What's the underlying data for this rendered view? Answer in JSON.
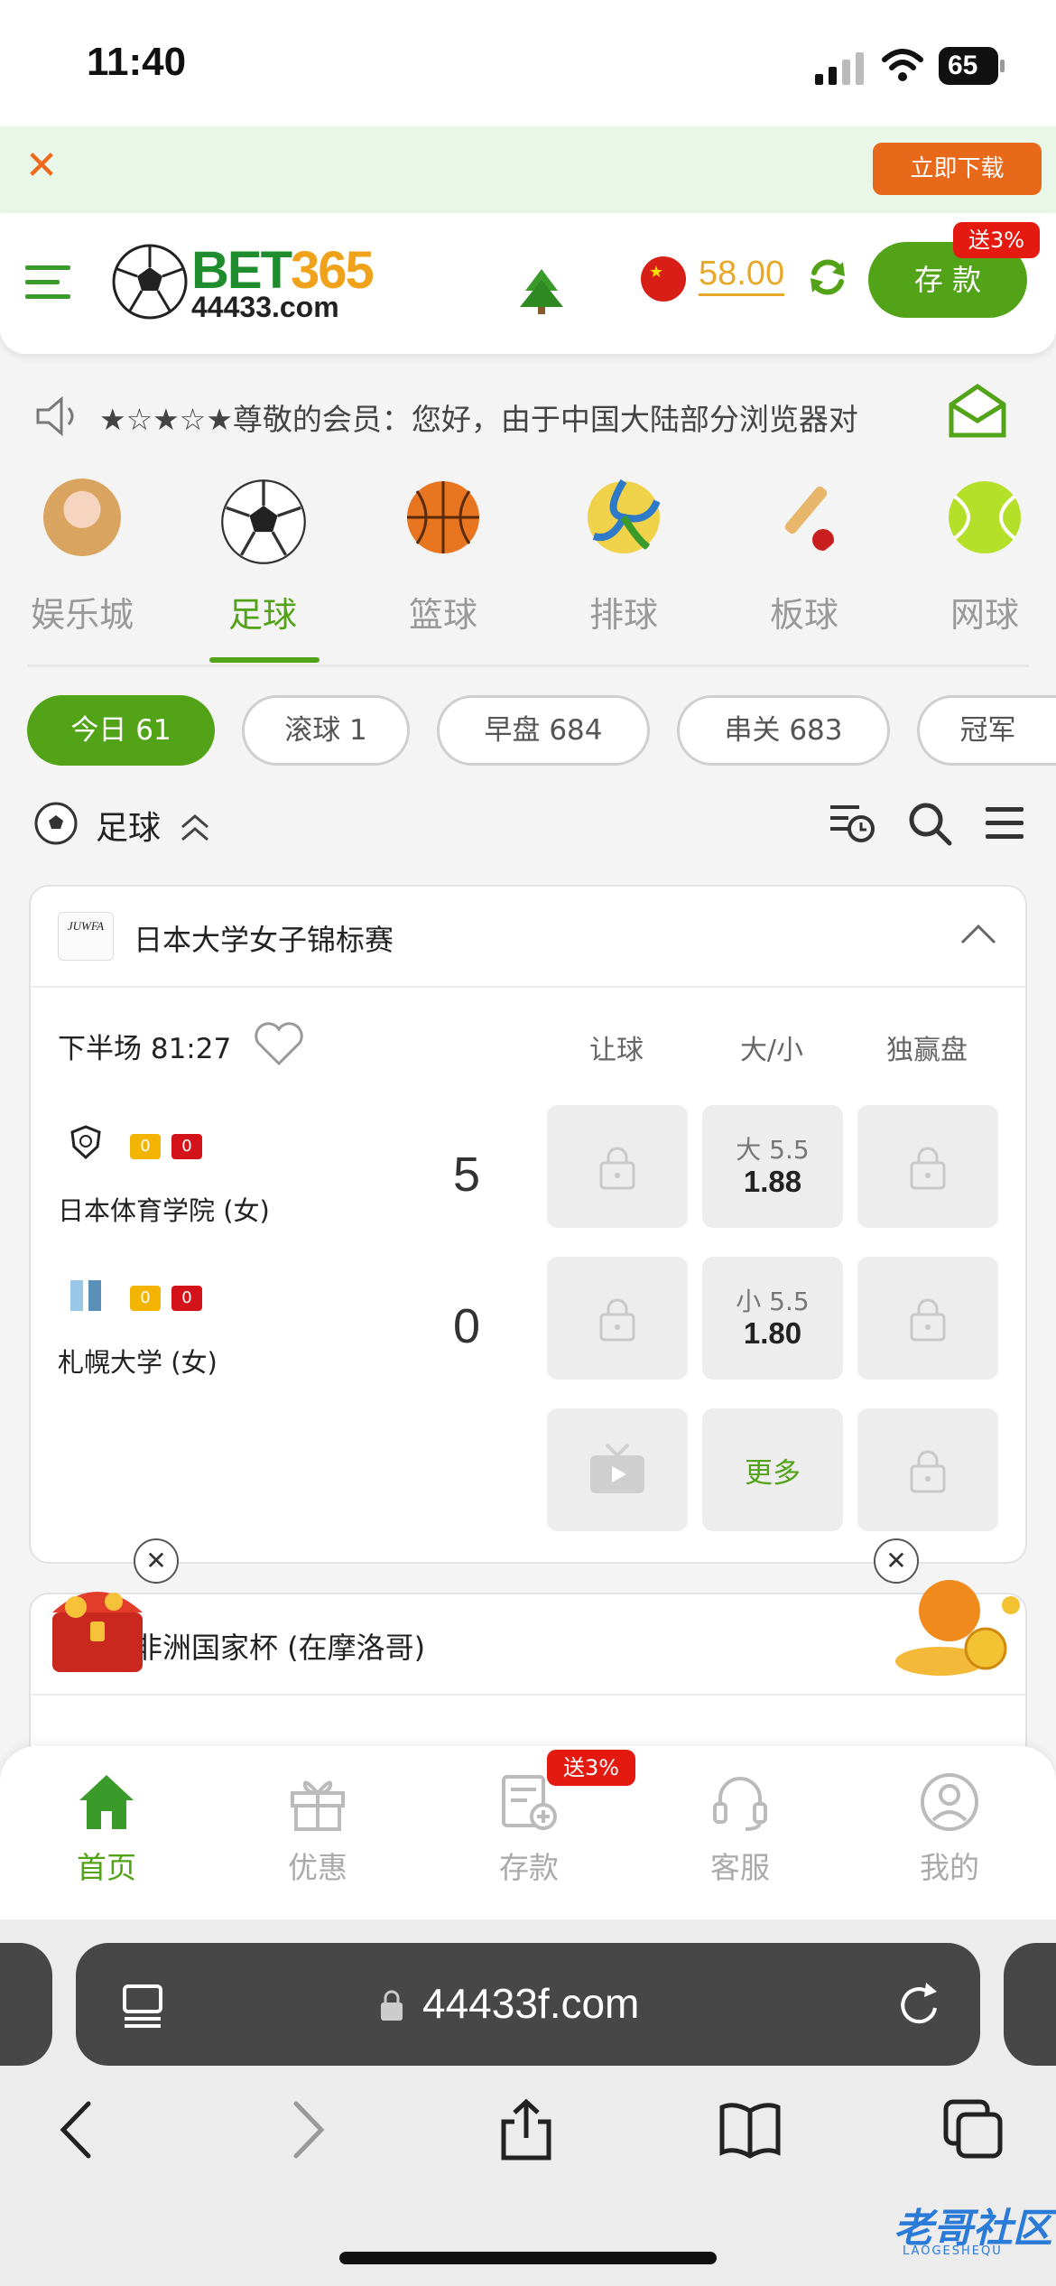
{
  "status_bar": {
    "time": "11:40",
    "battery": "65"
  },
  "banner": {
    "download_label": "立即下载"
  },
  "header": {
    "brand_text": "BET",
    "brand_num": "365",
    "brand_domain": "44433.com",
    "balance": "58.00",
    "deposit_label": "存 款",
    "deposit_badge": "送3%"
  },
  "notice": {
    "text": "★☆★☆★尊敬的会员：您好，由于中国大陆部分浏览器对"
  },
  "sport_tabs": [
    {
      "label": "娱乐城",
      "icon": "casino-girl-icon"
    },
    {
      "label": "足球",
      "icon": "soccer-ball-icon",
      "active": true
    },
    {
      "label": "篮球",
      "icon": "basketball-icon"
    },
    {
      "label": "排球",
      "icon": "volleyball-icon"
    },
    {
      "label": "板球",
      "icon": "cricket-icon"
    },
    {
      "label": "网球",
      "icon": "tennis-ball-icon"
    }
  ],
  "filter_chips": [
    {
      "label": "今日 61",
      "active": true
    },
    {
      "label": "滚球 1"
    },
    {
      "label": "早盘 684"
    },
    {
      "label": "串关 683"
    },
    {
      "label": "冠军"
    }
  ],
  "section": {
    "title": "足球"
  },
  "matches": [
    {
      "league": "日本大学女子锦标赛",
      "league_logo_text": "JUWFA",
      "time": "下半场  81:27",
      "columns": [
        "让球",
        "大/小",
        "独赢盘"
      ],
      "teams": [
        {
          "name": "日本体育学院 (女)",
          "yellow": "0",
          "red": "0",
          "score": "5",
          "ou_type": "大 5.5",
          "ou_odds": "1.88"
        },
        {
          "name": "札幌大学 (女)",
          "yellow": "0",
          "red": "0",
          "score": "0",
          "ou_type": "小 5.5",
          "ou_odds": "1.80"
        }
      ],
      "more_label": "更多"
    },
    {
      "league": "非洲国家杯 (在摩洛哥)"
    }
  ],
  "bottom_nav": [
    {
      "label": "首页",
      "icon": "home-icon",
      "active": true
    },
    {
      "label": "优惠",
      "icon": "gift-icon"
    },
    {
      "label": "存款",
      "icon": "deposit-icon",
      "badge": "送3%"
    },
    {
      "label": "客服",
      "icon": "headset-icon"
    },
    {
      "label": "我的",
      "icon": "user-icon"
    }
  ],
  "browser": {
    "url": "44433f.com"
  },
  "watermark": {
    "text": "老哥社区",
    "sub": "LAOGESHEQU"
  },
  "colors": {
    "brand_green": "#52a318",
    "accent_orange": "#e8691a",
    "badge_red": "#e4190f",
    "balance_gold": "#e8a92a"
  }
}
